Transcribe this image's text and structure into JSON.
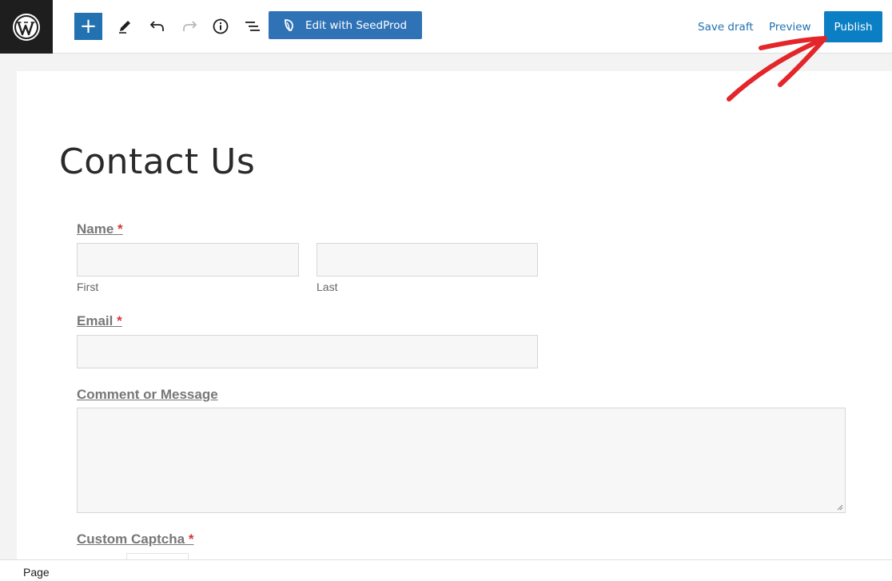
{
  "toolbar": {
    "add_label": "+",
    "seedprod_label": "Edit with SeedProd",
    "save_draft_label": "Save draft",
    "preview_label": "Preview",
    "publish_label": "Publish",
    "icons": [
      "wordpress-logo-icon",
      "plus-icon",
      "pencil-icon",
      "undo-icon",
      "redo-icon",
      "info-icon",
      "list-view-icon",
      "seedprod-leaf-icon"
    ],
    "accent_color": "#2271b1"
  },
  "page": {
    "title": "Contact Us"
  },
  "form": {
    "name": {
      "label": "Name",
      "required_mark": "*",
      "first_value": "",
      "last_value": "",
      "first_sublabel": "First",
      "last_sublabel": "Last"
    },
    "email": {
      "label": "Email",
      "required_mark": "*",
      "value": ""
    },
    "message": {
      "label": "Comment or Message",
      "value": ""
    },
    "captcha": {
      "label": "Custom Captcha",
      "required_mark": "*"
    }
  },
  "statusbar": {
    "label": "Page"
  },
  "annotation": {
    "arrow_color": "#e3262a"
  }
}
